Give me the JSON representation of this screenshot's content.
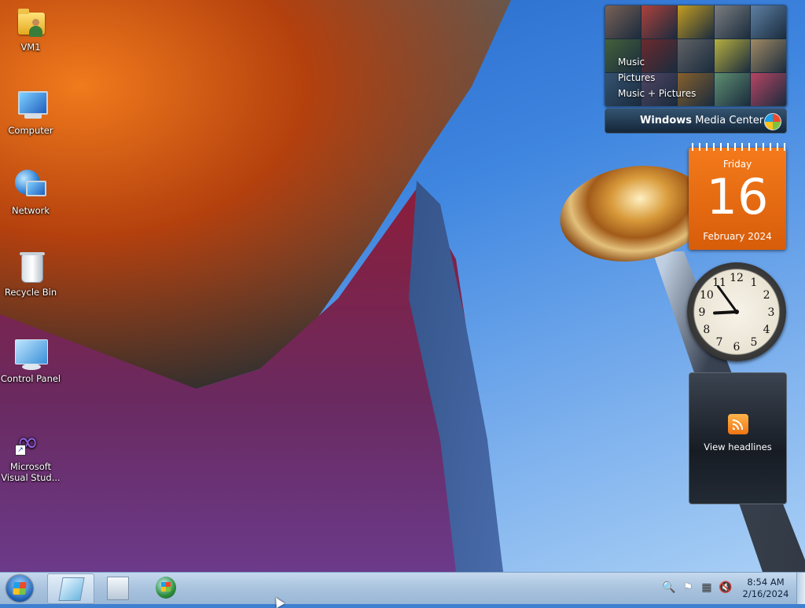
{
  "desktop": {
    "icons": [
      {
        "label": "VM1",
        "icon": "user-folder-icon"
      },
      {
        "label": "Computer",
        "icon": "computer-icon"
      },
      {
        "label": "Network",
        "icon": "network-icon"
      },
      {
        "label": "Recycle Bin",
        "icon": "recycle-bin-icon"
      },
      {
        "label": "Control Panel",
        "icon": "control-panel-icon"
      },
      {
        "label": "Microsoft Visual Stud...",
        "icon": "visual-studio-icon"
      }
    ]
  },
  "gadgets": {
    "media_center": {
      "menu": [
        "Music",
        "Pictures",
        "Music + Pictures"
      ],
      "title_a": "Windows",
      "title_b": "Media Center",
      "tile_colors": [
        "#8a6a5a",
        "#c7453b",
        "#e2b11c",
        "#8c8c8c",
        "#6a8fb5",
        "#4c6a3a",
        "#7a2a2a",
        "#6c6c6c",
        "#d2c640",
        "#b89a6a",
        "#3a5a7a",
        "#5a4a6a",
        "#9a6a2a",
        "#6aa07a",
        "#d24a6a"
      ]
    },
    "calendar": {
      "weekday": "Friday",
      "day": "16",
      "month_year": "February 2024"
    },
    "clock": {
      "numbers": [
        "12",
        "1",
        "2",
        "3",
        "4",
        "5",
        "6",
        "7",
        "8",
        "9",
        "10",
        "11"
      ],
      "hour": 8,
      "minute": 54
    },
    "feed": {
      "label": "View headlines",
      "icon": "rss-icon"
    }
  },
  "taskbar": {
    "start_icon": "windows-orb-icon",
    "items": [
      {
        "icon": "window-switcher-icon"
      },
      {
        "icon": "explorer-folder-icon"
      },
      {
        "icon": "media-player-icon"
      }
    ],
    "tray": {
      "icons": [
        "search-icon",
        "flag-icon",
        "network-icon",
        "volume-muted-icon"
      ],
      "time": "8:54 AM",
      "date": "2/16/2024"
    }
  },
  "colors": {
    "calendar_orange": "#e8680f",
    "taskbar_blue": "#a9c3de"
  }
}
